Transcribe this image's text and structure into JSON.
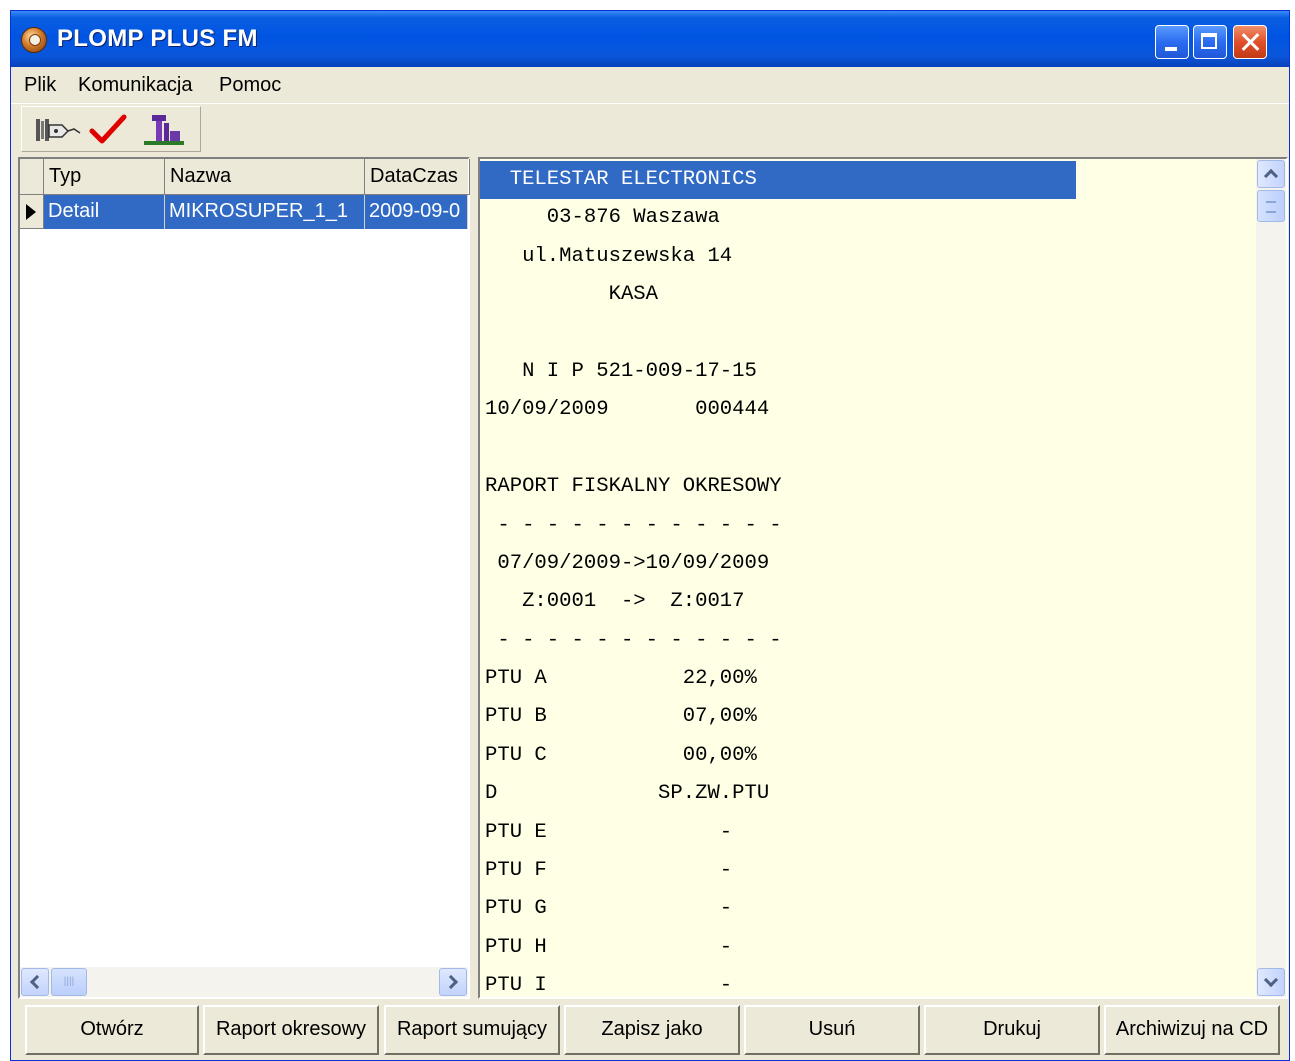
{
  "window": {
    "title": "PLOMP PLUS FM"
  },
  "menu": {
    "items": [
      "Plik",
      "Komunikacja",
      "Pomoc"
    ]
  },
  "toolbar": {
    "icons": [
      "connect-device-icon",
      "checkmark-icon",
      "archive-icon"
    ]
  },
  "grid": {
    "columns": [
      "Typ",
      "Nazwa",
      "DataCzas"
    ],
    "rows": [
      {
        "typ": "Detail",
        "nazwa": "MIKROSUPER_1_1",
        "data": "2009-09-0"
      }
    ]
  },
  "receipt": {
    "lines": [
      "  TELESTAR ELECTRONICS",
      "     03-876 Waszawa",
      "   ul.Matuszewska 14",
      "          KASA",
      "",
      "   N I P 521-009-17-15",
      "10/09/2009       000444",
      "",
      "RAPORT FISKALNY OKRESOWY",
      " - - - - - - - - - - - -",
      " 07/09/2009->10/09/2009",
      "   Z:0001  ->  Z:0017",
      " - - - - - - - - - - - -",
      "PTU A           22,00%",
      "PTU B           07,00%",
      "PTU C           00,00%",
      "D             SP.ZW.PTU",
      "PTU E              -",
      "PTU F              -",
      "PTU G              -",
      "PTU H              -",
      "PTU I              -"
    ]
  },
  "buttons": {
    "open": "Otwórz",
    "periodic_report": "Raport okresowy",
    "summary_report": "Raport sumujący",
    "save_as": "Zapisz jako",
    "delete": "Usuń",
    "print": "Drukuj",
    "archive_cd": "Archiwizuj na CD"
  },
  "colors": {
    "titlebar": "#0054e3",
    "selection": "#316ac5",
    "receipt_background": "#ffffe6",
    "window_face": "#ece9d8"
  }
}
